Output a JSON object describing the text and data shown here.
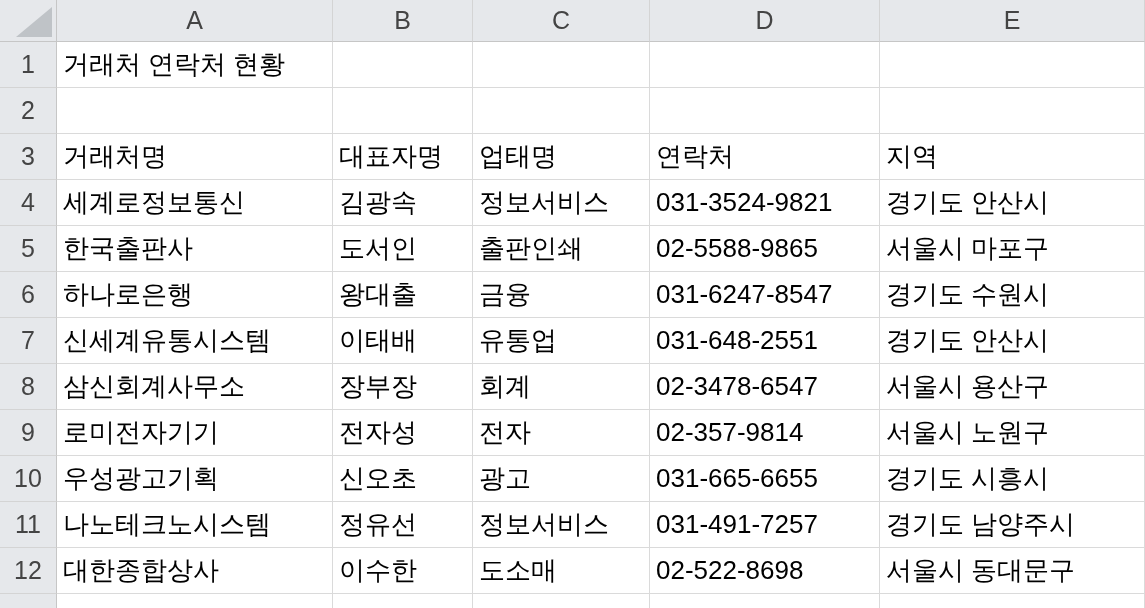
{
  "columns": [
    "A",
    "B",
    "C",
    "D",
    "E"
  ],
  "rows": [
    {
      "number": "1",
      "cells": [
        "거래처 연락처 현황"
      ]
    },
    {
      "number": "2"
    },
    {
      "number": "3",
      "cells": [
        "거래처명",
        "대표자명",
        "업태명",
        "연락처",
        "지역"
      ]
    },
    {
      "number": "4",
      "cells": [
        "세계로정보통신",
        "김광속",
        "정보서비스",
        "031-3524-9821",
        "경기도 안산시"
      ]
    },
    {
      "number": "5",
      "cells": [
        "한국출판사",
        "도서인",
        "출판인쇄",
        "02-5588-9865",
        "서울시 마포구"
      ]
    },
    {
      "number": "6",
      "cells": [
        "하나로은행",
        "왕대출",
        "금융",
        "031-6247-8547",
        "경기도 수원시"
      ]
    },
    {
      "number": "7",
      "cells": [
        "신세계유통시스템",
        "이태배",
        "유통업",
        "031-648-2551",
        "경기도 안산시"
      ]
    },
    {
      "number": "8",
      "cells": [
        "삼신회계사무소",
        "장부장",
        "회계",
        "02-3478-6547",
        "서울시 용산구"
      ]
    },
    {
      "number": "9",
      "cells": [
        "로미전자기기",
        "전자성",
        "전자",
        "02-357-9814",
        "서울시 노원구"
      ]
    },
    {
      "number": "10",
      "cells": [
        "우성광고기획",
        "신오초",
        "광고",
        "031-665-6655",
        "경기도 시흥시"
      ]
    },
    {
      "number": "11",
      "cells": [
        "나노테크노시스템",
        "정유선",
        "정보서비스",
        "031-491-7257",
        "경기도 남양주시"
      ]
    },
    {
      "number": "12",
      "cells": [
        "대한종합상사",
        "이수한",
        "도소매",
        "02-522-8698",
        "서울시 동대문구"
      ]
    }
  ]
}
